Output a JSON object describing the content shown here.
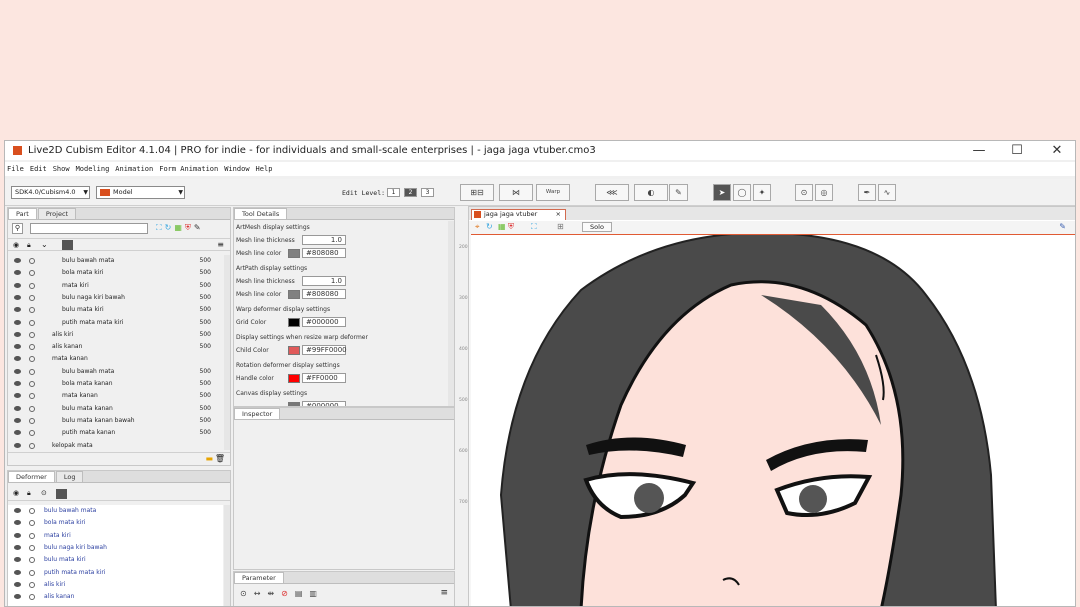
{
  "window": {
    "title": "Live2D Cubism Editor 4.1.04    | PRO for indie - for individuals and small-scale enterprises |  - jaga jaga vtuber.cmo3",
    "controls": {
      "minimize": "—",
      "maximize": "☐",
      "close": "✕"
    }
  },
  "menu": [
    "File",
    "Edit",
    "Show",
    "Modeling",
    "Animation",
    "Form Animation",
    "Window",
    "Help"
  ],
  "toolbar": {
    "version_select": "SDK4.0/Cubism4.0",
    "model_select": "Model",
    "edit_level_label": "Edit Level:",
    "edit_levels": [
      "1",
      "2",
      "3"
    ],
    "active_level": "2",
    "warp_label": "Warp"
  },
  "part_panel": {
    "tabs": [
      "Part",
      "Project"
    ],
    "rows": [
      {
        "label": "bulu bawah mata",
        "value": "500",
        "indent": 2
      },
      {
        "label": "bola mata kiri",
        "value": "500",
        "indent": 2
      },
      {
        "label": "mata kiri",
        "value": "500",
        "indent": 2
      },
      {
        "label": "bulu naga kiri bawah",
        "value": "500",
        "indent": 2
      },
      {
        "label": "bulu mata kiri",
        "value": "500",
        "indent": 2
      },
      {
        "label": "putih mata mata  kiri",
        "value": "500",
        "indent": 2
      },
      {
        "label": "alis kiri",
        "value": "500",
        "indent": 1
      },
      {
        "label": "alis kanan",
        "value": "500",
        "indent": 1
      },
      {
        "label": "mata kanan",
        "value": "",
        "indent": 1
      },
      {
        "label": "bulu bawah mata",
        "value": "500",
        "indent": 2
      },
      {
        "label": "bola mata kanan",
        "value": "500",
        "indent": 2
      },
      {
        "label": "mata kanan",
        "value": "500",
        "indent": 2
      },
      {
        "label": "bulu mata kanan",
        "value": "500",
        "indent": 2
      },
      {
        "label": "bulu mata kanan bawah",
        "value": "500",
        "indent": 2
      },
      {
        "label": "putih mata kanan",
        "value": "500",
        "indent": 2
      },
      {
        "label": "kelopak mata",
        "value": "",
        "indent": 1
      }
    ]
  },
  "deformer_panel": {
    "tabs": [
      "Deformer",
      "Log"
    ],
    "rows": [
      {
        "label": "bulu bawah mata"
      },
      {
        "label": "bola mata kiri"
      },
      {
        "label": "mata kiri"
      },
      {
        "label": "bulu naga kiri bawah"
      },
      {
        "label": "bulu mata kiri"
      },
      {
        "label": "putih mata mata  kiri"
      },
      {
        "label": "alis kiri"
      },
      {
        "label": "alis kanan"
      }
    ]
  },
  "tool_details": {
    "tab": "Tool Details",
    "sections": [
      {
        "heading": "ArtMesh display settings",
        "rows": [
          {
            "label": "Mesh line thickness",
            "value": "1.0"
          },
          {
            "label": "Mesh line color",
            "value": "#808080",
            "color": "#808080"
          }
        ]
      },
      {
        "heading": "ArtPath display settings",
        "rows": [
          {
            "label": "Mesh line thickness",
            "value": "1.0"
          },
          {
            "label": "Mesh line color",
            "value": "#808080",
            "color": "#808080"
          }
        ]
      },
      {
        "heading": "Warp deformer display settings",
        "rows": [
          {
            "label": "Grid Color",
            "value": "#000000",
            "color": "#000000"
          }
        ]
      },
      {
        "heading": "Display settings when resize warp deformer",
        "rows": [
          {
            "label": "Child Color",
            "value": "#99FF0000",
            "color": "#e05a5a"
          }
        ]
      },
      {
        "heading": "Rotation deformer display settings",
        "rows": [
          {
            "label": "Handle color",
            "value": "#FF0000",
            "color": "#ff0000"
          }
        ]
      },
      {
        "heading": "Canvas display settings",
        "rows": [
          {
            "label": "",
            "value": "#000000",
            "color": "#777777"
          }
        ]
      }
    ]
  },
  "inspector": {
    "tab": "Inspector"
  },
  "parameter": {
    "tab": "Parameter"
  },
  "canvas": {
    "tab_title": "jaga jaga vtuber",
    "solo_label": "Solo",
    "ruler_marks": [
      "200",
      "300",
      "400",
      "500",
      "600",
      "700"
    ]
  },
  "colors": {
    "accent": "#e05a33",
    "hair": "#4a4a4a",
    "skin": "#fde1da"
  }
}
